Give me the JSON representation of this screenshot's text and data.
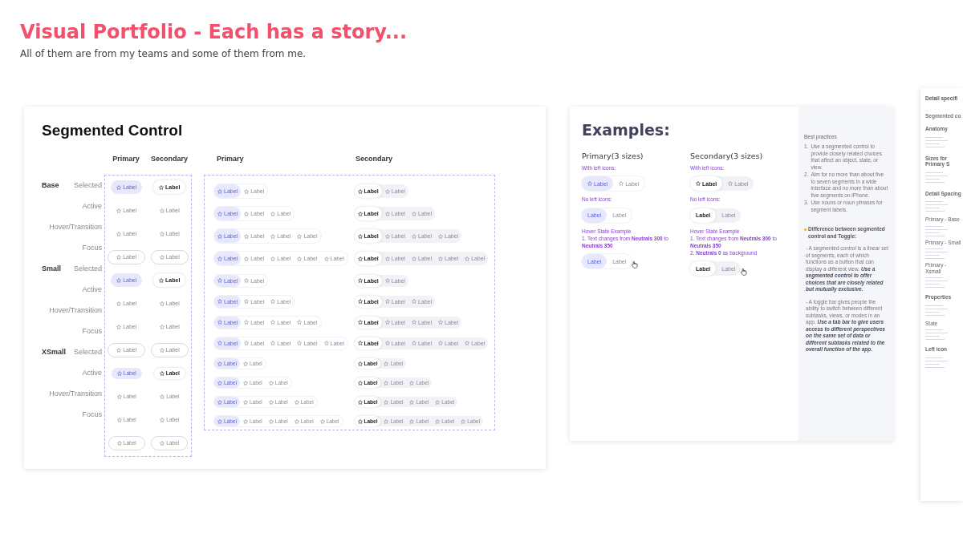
{
  "header": {
    "title": "Visual Portfolio - Each has a story...",
    "subtitle": "All of them are from my teams and some of them from me."
  },
  "segmented_card": {
    "title": "Segmented Control",
    "state_headers": [
      "Primary",
      "Secondary"
    ],
    "state_labels": [
      {
        "size": "Base",
        "state": "Selected"
      },
      {
        "state": "Active"
      },
      {
        "state": "Hover/Transition"
      },
      {
        "state": "Focus"
      },
      {
        "size": "Small",
        "state": "Selected"
      },
      {
        "state": "Active"
      },
      {
        "state": "Hover/Transition"
      },
      {
        "state": "Focus"
      },
      {
        "size": "XSmall",
        "state": "Selected"
      },
      {
        "state": "Active"
      },
      {
        "state": "Hover/Transition"
      },
      {
        "state": "Focus"
      }
    ],
    "state_chips": [
      {
        "kind": "selected",
        "primary": "Label",
        "secondary": "Label"
      },
      {
        "kind": "plain",
        "primary": "Label",
        "secondary": "Label"
      },
      {
        "kind": "plain",
        "primary": "Label",
        "secondary": "Label"
      },
      {
        "kind": "focus",
        "primary": "Label",
        "secondary": "Label"
      },
      {
        "kind": "selected",
        "primary": "Label",
        "secondary": "Label"
      },
      {
        "kind": "plain",
        "primary": "Label",
        "secondary": "Label"
      },
      {
        "kind": "plain",
        "primary": "Label",
        "secondary": "Label"
      },
      {
        "kind": "focus",
        "primary": "Label",
        "secondary": "Label"
      },
      {
        "kind": "selected",
        "primary": "Label",
        "secondary": "Label"
      },
      {
        "kind": "plain",
        "primary": "Label",
        "secondary": "Label"
      },
      {
        "kind": "plain",
        "primary": "Label",
        "secondary": "Label"
      },
      {
        "kind": "focus",
        "primary": "Label",
        "secondary": "Label"
      }
    ],
    "variant_headers": [
      "Primary",
      "Secondary"
    ],
    "variant_rows": [
      {
        "kind": "base",
        "primary": [
          {
            "label": "Label",
            "selected": true
          },
          {
            "label": "Label",
            "selected": false
          }
        ],
        "secondary": [
          {
            "label": "Label",
            "selected": true
          },
          {
            "label": "Label",
            "selected": false
          }
        ]
      },
      {
        "kind": "base",
        "primary": [
          {
            "label": "Label",
            "selected": true
          },
          {
            "label": "Label",
            "selected": false
          },
          {
            "label": "Label",
            "selected": false
          }
        ],
        "secondary": [
          {
            "label": "Label",
            "selected": true
          },
          {
            "label": "Label",
            "selected": false
          },
          {
            "label": "Label",
            "selected": false
          }
        ]
      },
      {
        "kind": "base",
        "primary": [
          {
            "label": "Label",
            "selected": true
          },
          {
            "label": "Label",
            "selected": false
          },
          {
            "label": "Label",
            "selected": false
          },
          {
            "label": "Label",
            "selected": false
          }
        ],
        "secondary": [
          {
            "label": "Label",
            "selected": true
          },
          {
            "label": "Label",
            "selected": false
          },
          {
            "label": "Label",
            "selected": false
          },
          {
            "label": "Label",
            "selected": false
          }
        ]
      },
      {
        "kind": "base",
        "primary": [
          {
            "label": "Label",
            "selected": true
          },
          {
            "label": "Label",
            "selected": false
          },
          {
            "label": "Label",
            "selected": false
          },
          {
            "label": "Label",
            "selected": false
          },
          {
            "label": "Label",
            "selected": false
          }
        ],
        "secondary": [
          {
            "label": "Label",
            "selected": true
          },
          {
            "label": "Label",
            "selected": false
          },
          {
            "label": "Label",
            "selected": false
          },
          {
            "label": "Label",
            "selected": false
          },
          {
            "label": "Label",
            "selected": false
          }
        ]
      },
      {
        "kind": "small",
        "primary": [
          {
            "label": "Label",
            "selected": true
          },
          {
            "label": "Label",
            "selected": false
          }
        ],
        "secondary": [
          {
            "label": "Label",
            "selected": true
          },
          {
            "label": "Label",
            "selected": false
          }
        ]
      },
      {
        "kind": "small",
        "primary": [
          {
            "label": "Label",
            "selected": true
          },
          {
            "label": "Label",
            "selected": false
          },
          {
            "label": "Label",
            "selected": false
          }
        ],
        "secondary": [
          {
            "label": "Label",
            "selected": true
          },
          {
            "label": "Label",
            "selected": false
          },
          {
            "label": "Label",
            "selected": false
          }
        ]
      },
      {
        "kind": "small",
        "primary": [
          {
            "label": "Label",
            "selected": true
          },
          {
            "label": "Label",
            "selected": false
          },
          {
            "label": "Label",
            "selected": false
          },
          {
            "label": "Label",
            "selected": false
          }
        ],
        "secondary": [
          {
            "label": "Label",
            "selected": true
          },
          {
            "label": "Label",
            "selected": false
          },
          {
            "label": "Label",
            "selected": false
          },
          {
            "label": "Label",
            "selected": false
          }
        ]
      },
      {
        "kind": "small",
        "primary": [
          {
            "label": "Label",
            "selected": true
          },
          {
            "label": "Label",
            "selected": false
          },
          {
            "label": "Label",
            "selected": false
          },
          {
            "label": "Label",
            "selected": false
          },
          {
            "label": "Label",
            "selected": false
          }
        ],
        "secondary": [
          {
            "label": "Label",
            "selected": true
          },
          {
            "label": "Label",
            "selected": false
          },
          {
            "label": "Label",
            "selected": false
          },
          {
            "label": "Label",
            "selected": false
          },
          {
            "label": "Label",
            "selected": false
          }
        ]
      },
      {
        "kind": "xsmall",
        "primary": [
          {
            "label": "Label",
            "selected": true
          },
          {
            "label": "Label",
            "selected": false
          }
        ],
        "secondary": [
          {
            "label": "Label",
            "selected": true
          },
          {
            "label": "Label",
            "selected": false
          }
        ]
      },
      {
        "kind": "xsmall",
        "primary": [
          {
            "label": "Label",
            "selected": true
          },
          {
            "label": "Label",
            "selected": false
          },
          {
            "label": "Label",
            "selected": false
          }
        ],
        "secondary": [
          {
            "label": "Label",
            "selected": true
          },
          {
            "label": "Label",
            "selected": false
          },
          {
            "label": "Label",
            "selected": false
          }
        ]
      },
      {
        "kind": "xsmall",
        "primary": [
          {
            "label": "Label",
            "selected": true
          },
          {
            "label": "Label",
            "selected": false
          },
          {
            "label": "Label",
            "selected": false
          },
          {
            "label": "Label",
            "selected": false
          }
        ],
        "secondary": [
          {
            "label": "Label",
            "selected": true
          },
          {
            "label": "Label",
            "selected": false
          },
          {
            "label": "Label",
            "selected": false
          },
          {
            "label": "Label",
            "selected": false
          }
        ]
      },
      {
        "kind": "xsmall",
        "primary": [
          {
            "label": "Label",
            "selected": true
          },
          {
            "label": "Label",
            "selected": false
          },
          {
            "label": "Label",
            "selected": false
          },
          {
            "label": "Label",
            "selected": false
          },
          {
            "label": "Label",
            "selected": false
          }
        ],
        "secondary": [
          {
            "label": "Label",
            "selected": true
          },
          {
            "label": "Label",
            "selected": false
          },
          {
            "label": "Label",
            "selected": false
          },
          {
            "label": "Label",
            "selected": false
          },
          {
            "label": "Label",
            "selected": false
          }
        ]
      }
    ]
  },
  "examples_card": {
    "title": "Examples:",
    "columns": [
      {
        "heading": "Primary(3 sizes)",
        "sections": [
          {
            "notes": [
              "With left icons:"
            ],
            "icons": true,
            "segments": [
              {
                "label": "Label",
                "selected": true,
                "hovered": false
              },
              {
                "label": "Label",
                "selected": false,
                "hovered": false
              }
            ]
          },
          {
            "notes": [
              "No left icons:"
            ],
            "icons": false,
            "segments": [
              {
                "label": "Label",
                "selected": true,
                "hovered": false
              },
              {
                "label": "Label",
                "selected": false,
                "hovered": false
              }
            ]
          },
          {
            "notes": [
              "Hover State Example",
              "1. Text changes from **Neutrals 300** to **Neutrals 350**"
            ],
            "icons": false,
            "segments": [
              {
                "label": "Label",
                "selected": true,
                "hovered": false
              },
              {
                "label": "Label",
                "selected": false,
                "hovered": true
              }
            ]
          }
        ]
      },
      {
        "heading": "Secondary(3 sizes)",
        "sections": [
          {
            "notes": [
              "With left icons:"
            ],
            "icons": true,
            "segments": [
              {
                "label": "Label",
                "selected": true,
                "hovered": false
              },
              {
                "label": "Label",
                "selected": false,
                "hovered": false
              }
            ]
          },
          {
            "notes": [
              "No left icons:"
            ],
            "icons": false,
            "segments": [
              {
                "label": "Label",
                "selected": true,
                "hovered": false
              },
              {
                "label": "Label",
                "selected": false,
                "hovered": false
              }
            ]
          },
          {
            "notes": [
              "Hover State Example",
              "1. Text changes from **Neutrals 300** to **Neutrals 350**",
              "2. **Neutrals 0** as background"
            ],
            "icons": false,
            "segments": [
              {
                "label": "Label",
                "selected": true,
                "hovered": false
              },
              {
                "label": "Label",
                "selected": false,
                "hovered": true
              }
            ]
          }
        ]
      }
    ],
    "side": {
      "heading": "Best practices",
      "practices": [
        {
          "number": "1.",
          "text": "Use a segmented control to provide closely related choices that affect an object, state, or view."
        },
        {
          "number": "2.",
          "text": "Aim for no more than about five to seven segments in a wide interface and no more than about five segments on iPhone."
        },
        {
          "number": "3.",
          "text": "Use nouns or noun phrases for segment labels."
        }
      ],
      "difference_title": "Difference between segmented control and Toggle:",
      "paragraphs": [
        "- A segmented control is a linear set of segments, each of which functions as a button that can display a different view. **Use a segmented control to offer choices that are closely related but mutually exclusive.**",
        "- A toggle bar gives people the ability to switch between different subtasks, views, or modes in an app. **Use a tab bar to give users access to different perspectives on the same set of data or different subtasks related to the overall function of the app.**"
      ]
    }
  },
  "spec_card": {
    "title": "Detail specifi",
    "subtitle": "Segmented co",
    "sections": [
      {
        "kind": "heading",
        "text": "Anatomy"
      },
      {
        "kind": "heading",
        "text": "Sizes for Primary S"
      },
      {
        "kind": "heading",
        "text": "Detail Spacing"
      },
      {
        "kind": "subheading",
        "text": "Primary - Base"
      },
      {
        "kind": "subheading",
        "text": "Primary - Small"
      },
      {
        "kind": "subheading",
        "text": "Primary - Xsmall"
      },
      {
        "kind": "heading",
        "text": "Properties"
      },
      {
        "kind": "subheading",
        "text": "State"
      },
      {
        "kind": "heading",
        "text": "Left icon"
      }
    ]
  }
}
